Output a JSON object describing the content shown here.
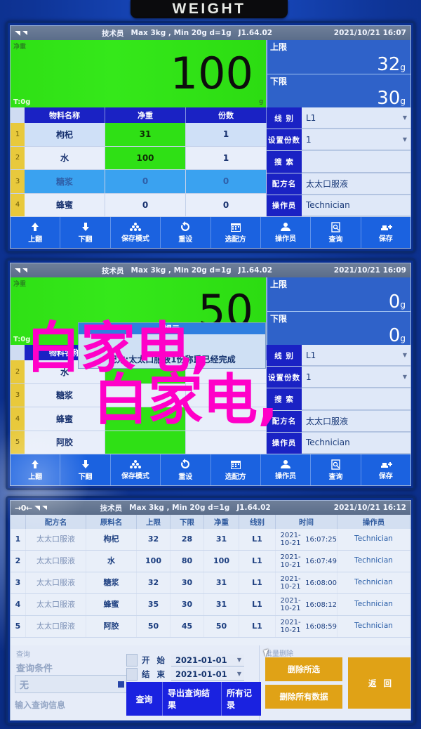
{
  "device": {
    "title": "WEIGHT"
  },
  "common": {
    "status": {
      "operator": "技术员",
      "capacity": "Max 3kg , Min 20g  d=1g",
      "version": "J1.64.02"
    },
    "labels": {
      "net": "净重",
      "tare": "T:0g",
      "unit_g": "g",
      "upper_limit": "上限",
      "lower_limit": "下限"
    },
    "material_headers": [
      "物料名称",
      "净重",
      "份数"
    ],
    "side_keys": {
      "line": "线  别",
      "portions": "设置份数",
      "search": "搜  索",
      "recipe": "配方名",
      "operator": "操作员"
    },
    "toolbar": [
      {
        "label": "上翻",
        "icon": "arrow-up-icon"
      },
      {
        "label": "下翻",
        "icon": "arrow-down-icon"
      },
      {
        "label": "保存模式",
        "icon": "stack-icon"
      },
      {
        "label": "重设",
        "icon": "refresh-icon"
      },
      {
        "label": "选配方",
        "icon": "calendar-icon"
      },
      {
        "label": "操作员",
        "icon": "user-icon"
      },
      {
        "label": "查询",
        "icon": "document-search-icon"
      },
      {
        "label": "保存",
        "icon": "save-plus-icon"
      }
    ]
  },
  "panel1": {
    "status_time": "2021/10/21  16:07",
    "display_value": "100",
    "upper_limit": "32",
    "lower_limit": "30",
    "materials": [
      {
        "idx": "1",
        "name": "枸杞",
        "net": "31",
        "portions": "1"
      },
      {
        "idx": "2",
        "name": "水",
        "net": "100",
        "portions": "1"
      },
      {
        "idx": "3",
        "name": "糖浆",
        "net": "0",
        "portions": "0"
      },
      {
        "idx": "4",
        "name": "蜂蜜",
        "net": "0",
        "portions": "0"
      }
    ],
    "side_values": {
      "line": "L1",
      "portions": "1",
      "search": "",
      "recipe": "太太口服液",
      "operator": "Technician"
    }
  },
  "panel2": {
    "status_time": "2021/10/21  16:09",
    "display_value": "50",
    "upper_limit": "0",
    "lower_limit": "0",
    "dialog": {
      "title": "提示",
      "message": "配方:太太口服液1份称重已经完成"
    },
    "materials": [
      {
        "idx": "2",
        "name": "水",
        "net": "",
        "portions": ""
      },
      {
        "idx": "3",
        "name": "糖浆",
        "net": "",
        "portions": ""
      },
      {
        "idx": "4",
        "name": "蜂蜜",
        "net": "",
        "portions": ""
      },
      {
        "idx": "5",
        "name": "阿胶",
        "net": "",
        "portions": ""
      }
    ],
    "side_values": {
      "line": "L1",
      "portions": "1",
      "search": "",
      "recipe": "太太口服液",
      "operator": "Technician"
    },
    "watermark": {
      "line1": "白家电,",
      "line2": "白家电,"
    }
  },
  "panel3": {
    "status_time": "2021/10/21  16:12",
    "zero_indicator": "→0←",
    "table": {
      "headers": [
        "配方名",
        "原料名",
        "上限",
        "下限",
        "净重",
        "线别",
        "时间",
        "操作员"
      ],
      "rows": [
        {
          "idx": "1",
          "recipe": "太太口服液",
          "material": "枸杞",
          "upper": "32",
          "lower": "28",
          "net": "31",
          "line": "L1",
          "date": "2021-10-21",
          "time": "16:07:25",
          "operator": "Technician"
        },
        {
          "idx": "2",
          "recipe": "太太口服液",
          "material": "水",
          "upper": "100",
          "lower": "80",
          "net": "100",
          "line": "L1",
          "date": "2021-10-21",
          "time": "16:07:49",
          "operator": "Technician"
        },
        {
          "idx": "3",
          "recipe": "太太口服液",
          "material": "糖浆",
          "upper": "32",
          "lower": "30",
          "net": "31",
          "line": "L1",
          "date": "2021-10-21",
          "time": "16:08:00",
          "operator": "Technician"
        },
        {
          "idx": "4",
          "recipe": "太太口服液",
          "material": "蜂蜜",
          "upper": "35",
          "lower": "30",
          "net": "31",
          "line": "L1",
          "date": "2021-10-21",
          "time": "16:08:12",
          "operator": "Technician"
        },
        {
          "idx": "5",
          "recipe": "太太口服液",
          "material": "阿胶",
          "upper": "50",
          "lower": "45",
          "net": "50",
          "line": "L1",
          "date": "2021-10-21",
          "time": "16:08:59",
          "operator": "Technician"
        }
      ]
    },
    "query": {
      "group_title": "查询",
      "condition_label": "查询条件",
      "condition_value": "无",
      "hint": "输入查询信息",
      "start_label": "开  始",
      "start_date": "2021-01-01",
      "end_label": "结  束",
      "end_date": "2021-01-01",
      "buttons": [
        "查询",
        "导出查询结果",
        "所有记录"
      ]
    },
    "batch_delete": {
      "group_title": "批量删除",
      "delete_selected": "删除所选",
      "delete_all": "删除所有数据",
      "back": "返    回"
    }
  }
}
